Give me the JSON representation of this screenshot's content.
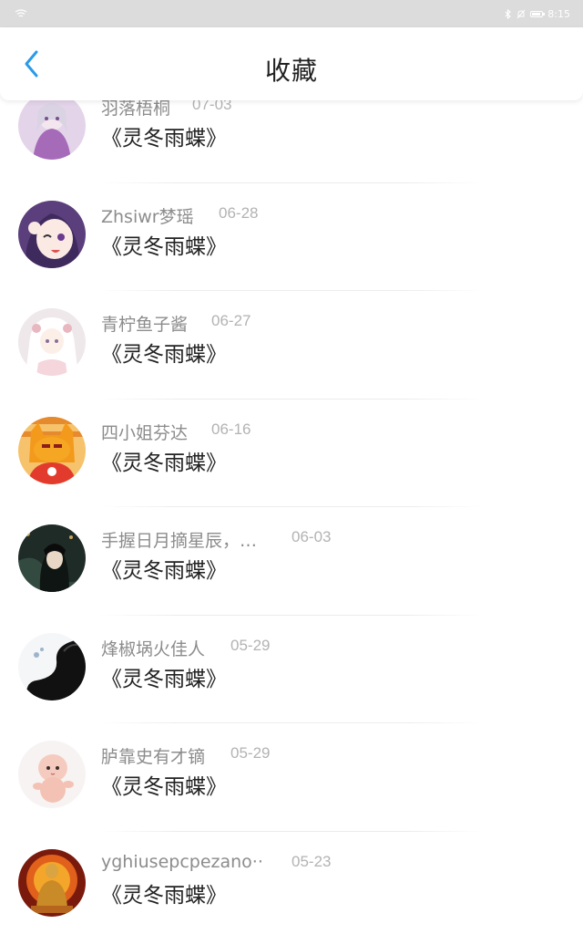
{
  "status": {
    "time": "8:15"
  },
  "header": {
    "title": "收藏"
  },
  "items": [
    {
      "name": "羽落梧桐",
      "date": "07-03",
      "work": "《灵冬雨蝶》",
      "avatar_color": "#c9a9d6"
    },
    {
      "name": "Zhsiwr梦瑶",
      "date": "06-28",
      "work": "《灵冬雨蝶》",
      "avatar_color": "#6a4e8c"
    },
    {
      "name": "青柠鱼子酱",
      "date": "06-27",
      "work": "《灵冬雨蝶》",
      "avatar_color": "#e7e0e2"
    },
    {
      "name": "四小姐芬达",
      "date": "06-16",
      "work": "《灵冬雨蝶》",
      "avatar_color": "#f0a030"
    },
    {
      "name": "手握日月摘星辰，…",
      "date": "06-03",
      "work": "《灵冬雨蝶》",
      "avatar_color": "#2d3a34"
    },
    {
      "name": "烽椒埚火佳人",
      "date": "05-29",
      "work": "《灵冬雨蝶》",
      "avatar_color": "#1a1a1a"
    },
    {
      "name": "胪靠史有才镝",
      "date": "05-29",
      "work": "《灵冬雨蝶》",
      "avatar_color": "#f5d2c8"
    },
    {
      "name": "yghiusepcpezano··",
      "date": "05-23",
      "work": "《灵冬雨蝶》",
      "avatar_color": "#c8441a"
    }
  ]
}
